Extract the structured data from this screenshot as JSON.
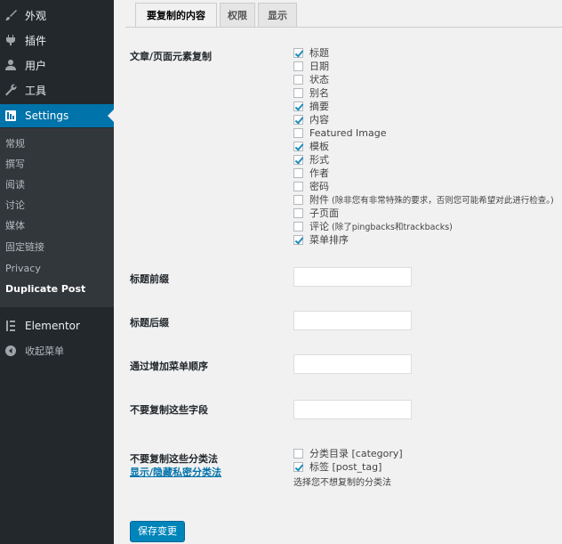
{
  "sidebar": {
    "menu": [
      {
        "label": "外观",
        "icon": "paintbrush-icon"
      },
      {
        "label": "插件",
        "icon": "plugin-icon"
      },
      {
        "label": "用户",
        "icon": "user-icon"
      },
      {
        "label": "工具",
        "icon": "wrench-icon"
      },
      {
        "label": "Settings",
        "icon": "settings-icon"
      }
    ],
    "submenu": [
      "常规",
      "撰写",
      "阅读",
      "讨论",
      "媒体",
      "固定链接",
      "Privacy",
      "Duplicate Post"
    ],
    "elementor": {
      "label": "Elementor",
      "icon": "elementor-icon"
    },
    "collapse": {
      "label": "收起菜单",
      "icon": "collapse-icon"
    }
  },
  "tabs": [
    "要复制的内容",
    "权限",
    "显示"
  ],
  "form": {
    "elements_label": "文章/页面元素复制",
    "elements": [
      {
        "label": "标题",
        "checked": true
      },
      {
        "label": "日期",
        "checked": false
      },
      {
        "label": "状态",
        "checked": false
      },
      {
        "label": "别名",
        "checked": false
      },
      {
        "label": "摘要",
        "checked": true
      },
      {
        "label": "内容",
        "checked": true
      },
      {
        "label": "Featured Image",
        "checked": false
      },
      {
        "label": "模板",
        "checked": true
      },
      {
        "label": "形式",
        "checked": true
      },
      {
        "label": "作者",
        "checked": false
      },
      {
        "label": "密码",
        "checked": false
      },
      {
        "label": "附件",
        "note": "(除非您有非常特殊的要求，否则您可能希望对此进行检查。)",
        "checked": false
      },
      {
        "label": "子页面",
        "checked": false
      },
      {
        "label": "评论",
        "note": "(除了pingbacks和trackbacks)",
        "checked": false
      },
      {
        "label": "菜单排序",
        "checked": true
      }
    ],
    "title_prefix_label": "标题前缀",
    "title_prefix_value": "",
    "title_suffix_label": "标题后缀",
    "title_suffix_value": "",
    "menu_order_label": "通过增加菜单顺序",
    "menu_order_value": "",
    "skip_fields_label": "不要复制这些字段",
    "skip_fields_value": "",
    "taxonomies_label": "不要复制这些分类法",
    "taxonomies_toggle_link": "显示/隐藏私密分类法",
    "taxonomies": [
      {
        "label": "分类目录 [category]",
        "checked": false
      },
      {
        "label": "标签 [post_tag]",
        "checked": true
      }
    ],
    "taxonomies_desc": "选择您不想复制的分类法"
  },
  "save_button": "保存变更",
  "colors": {
    "accent": "#0073aa",
    "sidebar_bg": "#23282d",
    "submenu_bg": "#32373c",
    "button": "#0085ba"
  }
}
